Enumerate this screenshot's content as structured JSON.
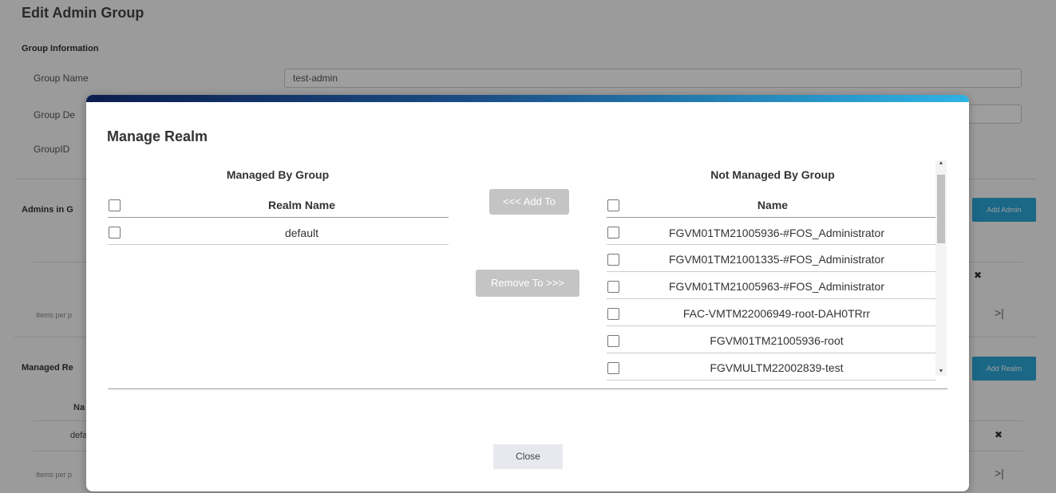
{
  "background": {
    "page_title": "Edit Admin Group",
    "group_info_title": "Group Information",
    "group_name_label": "Group Name",
    "group_name_value": "test-admin",
    "group_desc_label": "Group De",
    "group_id_label": "GroupID",
    "admins_section": "Admins in G",
    "add_admin_label": "Add Admin",
    "items_per_page_1": "Items per p",
    "managed_section": "Managed Re",
    "add_realm_label": "Add Realm",
    "col_name_fragment": "Na",
    "row_default_fragment": "defa",
    "items_per_page_2": "Items per p",
    "last_page_icon": ">|"
  },
  "modal": {
    "title": "Manage Realm",
    "left_panel": {
      "heading": "Managed By Group",
      "column_header": "Realm Name",
      "rows": [
        "default"
      ]
    },
    "add_button": "<<< Add To",
    "remove_button": "Remove To >>>",
    "right_panel": {
      "heading": "Not Managed By Group",
      "column_header": "Name",
      "rows": [
        "FGVM01TM21005936-#FOS_Administrator",
        "FGVM01TM21001335-#FOS_Administrator",
        "FGVM01TM21005963-#FOS_Administrator",
        "FAC-VMTM22006949-root-DAH0TRrr",
        "FGVM01TM21005936-root",
        "FGVMULTM22002839-test"
      ]
    },
    "close_button": "Close",
    "accent_gradient": [
      "#0c1d4f",
      "#2fb3e4"
    ]
  }
}
